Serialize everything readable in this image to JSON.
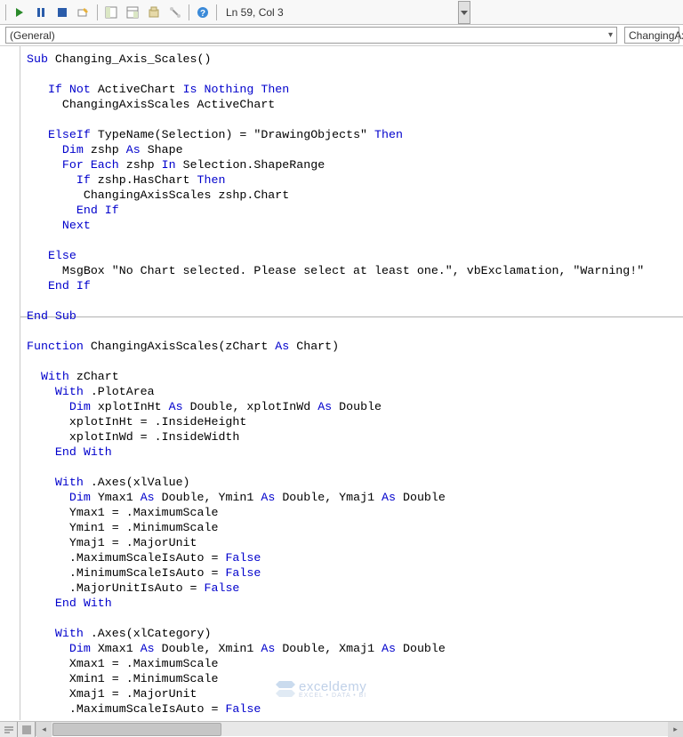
{
  "toolbar": {
    "status": "Ln 59, Col 3"
  },
  "dropdowns": {
    "object": "(General)",
    "procedure": "ChangingAx"
  },
  "watermark": {
    "brand": "exceldemy",
    "tagline": "EXCEL • DATA • BI"
  },
  "code": {
    "sub_decl_a": "Sub",
    "sub_decl_b": " Changing_Axis_Scales()",
    "if_not": "If Not",
    "activechart": " ActiveChart ",
    "is_nothing_then": "Is Nothing Then",
    "call1": "     ChangingAxisScales ActiveChart",
    "elseif": "ElseIf",
    "typename_eq": " TypeName(Selection) = \"DrawingObjects\" ",
    "then": "Then",
    "dim": "Dim",
    "zshp_as_shape": " zshp ",
    "as": "As",
    "shape": " Shape",
    "for_each": "For Each",
    "zshp_in": " zshp ",
    "in": "In",
    "sel_range": " Selection.ShapeRange",
    "if": "If",
    "haschart_then": " zshp.HasChart ",
    "call2": "        ChangingAxisScales zshp.Chart",
    "end_if": "End If",
    "next": "Next",
    "else": "Else",
    "msgbox_line": "     MsgBox \"No Chart selected. Please select at least one.\", vbExclamation, \"Warning!\"",
    "end_sub": "End Sub",
    "function": "Function",
    "func_sig": " ChangingAxisScales(zChart ",
    "chart_paren": " Chart)",
    "with": "With",
    "zchart": " zChart",
    "plotarea": " .PlotArea",
    "xplot_decl_mid": " xplotInHt ",
    "double_comma": " Double, xplotInWd ",
    "double": " Double",
    "xplot_ht": "      xplotInHt = .InsideHeight",
    "xplot_wd": "      xplotInWd = .InsideWidth",
    "end_with": "End With",
    "axes_val": " .Axes(xlValue)",
    "y_decl1": " Ymax1 ",
    "y_decl2": " Double, Ymin1 ",
    "y_decl3": " Double, Ymaj1 ",
    "ymax1": "      Ymax1 = .MaximumScale",
    "ymin1": "      Ymin1 = .MinimumScale",
    "ymaj1": "      Ymaj1 = .MajorUnit",
    "maxauto": "      .MaximumScaleIsAuto = ",
    "minauto": "      .MinimumScaleIsAuto = ",
    "majauto": "      .MajorUnitIsAuto = ",
    "false": "False",
    "axes_cat": " .Axes(xlCategory)",
    "x_decl1": " Xmax1 ",
    "x_decl2": " Double, Xmin1 ",
    "x_decl3": " Double, Xmaj1 ",
    "xmax1": "      Xmax1 = .MaximumScale",
    "xmin1": "      Xmin1 = .MinimumScale",
    "xmaj1": "      Xmaj1 = .MajorUnit"
  }
}
